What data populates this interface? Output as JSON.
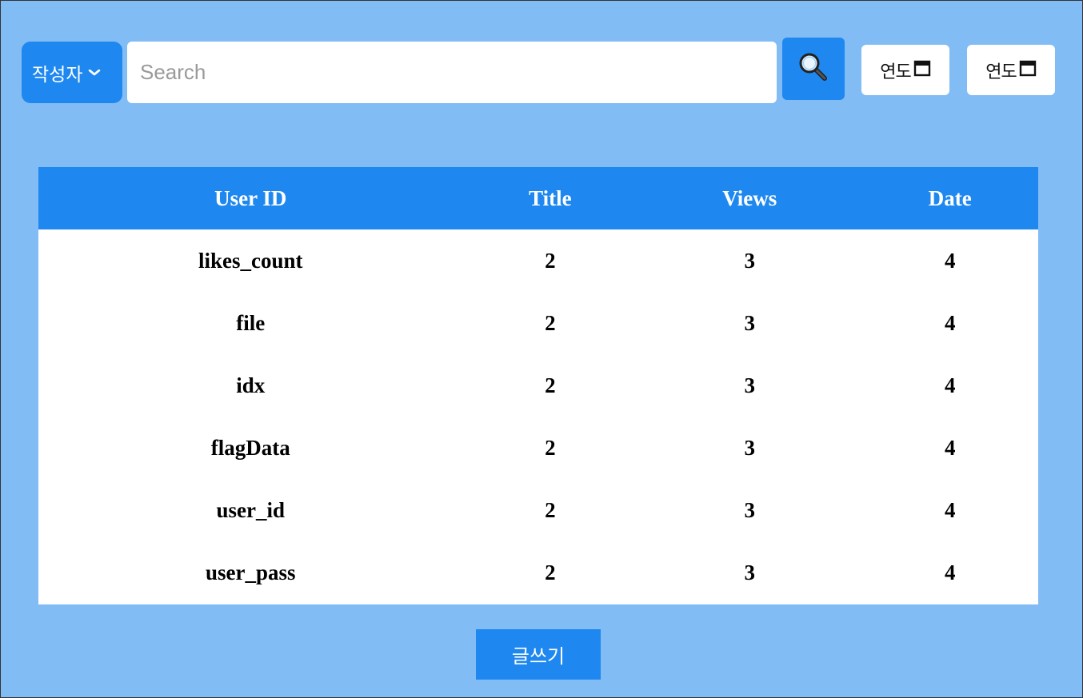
{
  "colors": {
    "background": "#82bcf5",
    "accent": "#1e88f0",
    "surface": "#ffffff"
  },
  "filter": {
    "selected": "작성자",
    "icon": "chevron-down-icon"
  },
  "search": {
    "placeholder": "Search",
    "value": "",
    "button_icon": "magnifier-icon"
  },
  "dates": [
    {
      "label": "연도",
      "icon": "calendar-icon"
    },
    {
      "label": "연도",
      "icon": "calendar-icon"
    }
  ],
  "table": {
    "headers": [
      "User ID",
      "Title",
      "Views",
      "Date"
    ],
    "rows": [
      [
        "likes_count",
        "2",
        "3",
        "4"
      ],
      [
        "file",
        "2",
        "3",
        "4"
      ],
      [
        "idx",
        "2",
        "3",
        "4"
      ],
      [
        "flagData",
        "2",
        "3",
        "4"
      ],
      [
        "user_id",
        "2",
        "3",
        "4"
      ],
      [
        "user_pass",
        "2",
        "3",
        "4"
      ]
    ]
  },
  "write_button": {
    "label": "글쓰기"
  }
}
